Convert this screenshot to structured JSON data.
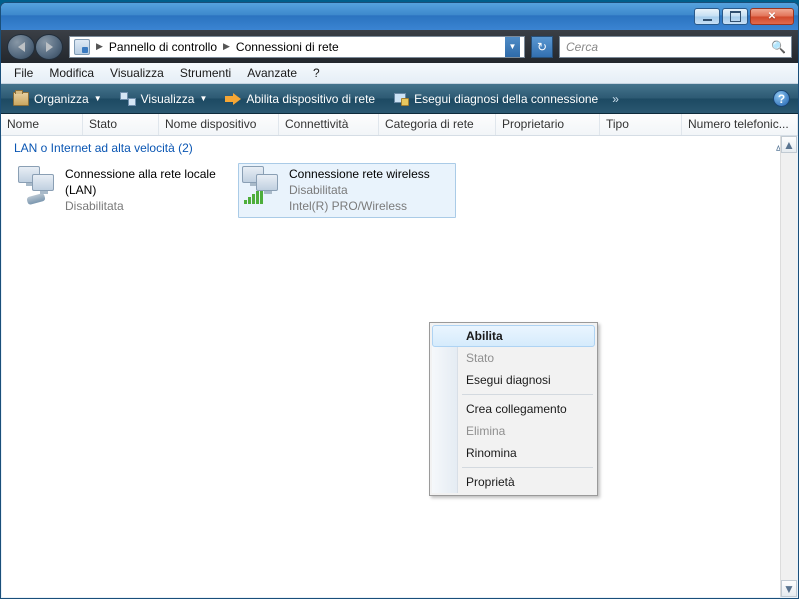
{
  "breadcrumb": {
    "root": "Pannello di controllo",
    "current": "Connessioni di rete"
  },
  "search": {
    "placeholder": "Cerca"
  },
  "menubar": {
    "file": "File",
    "edit": "Modifica",
    "view": "Visualizza",
    "tools": "Strumenti",
    "advanced": "Avanzate",
    "help": "?"
  },
  "toolbar": {
    "organize": "Organizza",
    "views": "Visualizza",
    "enable": "Abilita dispositivo di rete",
    "diagnose": "Esegui diagnosi della connessione"
  },
  "columns": {
    "name": "Nome",
    "status": "Stato",
    "devname": "Nome dispositivo",
    "connectivity": "Connettività",
    "category": "Categoria di rete",
    "owner": "Proprietario",
    "type": "Tipo",
    "phone": "Numero telefonic..."
  },
  "group": {
    "title": "LAN o Internet ad alta velocità (2)"
  },
  "connections": [
    {
      "name": "Connessione alla rete locale (LAN)",
      "status": "Disabilitata",
      "device": ""
    },
    {
      "name": "Connessione rete wireless",
      "status": "Disabilitata",
      "device": "Intel(R) PRO/Wireless"
    }
  ],
  "context": {
    "enable": "Abilita",
    "status": "Stato",
    "diagnose": "Esegui diagnosi",
    "shortcut": "Crea collegamento",
    "delete": "Elimina",
    "rename": "Rinomina",
    "properties": "Proprietà"
  }
}
